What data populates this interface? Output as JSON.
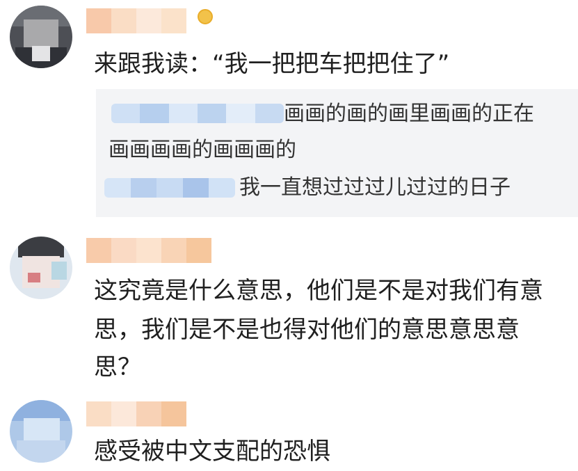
{
  "comments": [
    {
      "avatar_icon": "user-avatar-icon",
      "username": "",
      "text": "来跟我读：“我一把把车把把住了”",
      "replies": [
        {
          "line1": "画画的画的画里画画的正在",
          "line2": "画画画画的画画画的"
        },
        {
          "line1": "我一直想过过过儿过过的日子"
        }
      ]
    },
    {
      "avatar_icon": "user-avatar-icon",
      "username": "",
      "text_line1": "这究竟是什么意思，他们是不是对我们有意",
      "text_line2": "思，我们是不是也得对他们的意思意思意",
      "text_line3": "思？"
    },
    {
      "avatar_icon": "user-avatar-icon",
      "username": "",
      "text": "感受被中文支配的恐惧"
    }
  ],
  "colors": {
    "reply_bg": "#f3f4f6",
    "text": "#1f1f1f",
    "blur_orange": "#f7c89f",
    "blur_blue": "#bcd3ef"
  }
}
